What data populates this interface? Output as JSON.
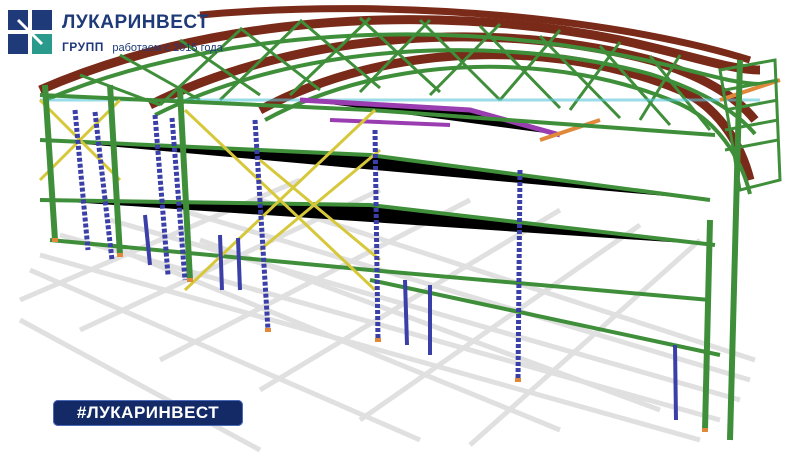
{
  "brand": {
    "name": "ЛУКАРИНВЕСТ",
    "group": "ГРУПП",
    "tagline": "работаем с 2015 года",
    "logo_colors": [
      "#1f3a78",
      "#2a9a8c"
    ]
  },
  "hashtag": "#ЛУКАРИНВЕСТ",
  "colors": {
    "column_green": "#3f8f3a",
    "column_blue": "#3b3fa8",
    "arch_brown": "#7a2a18",
    "brace_yellow": "#d6c83a",
    "purple": "#9a3db0",
    "orange": "#e0893a",
    "shadow": "#c9c9c9",
    "badge_bg": "#142a66"
  }
}
